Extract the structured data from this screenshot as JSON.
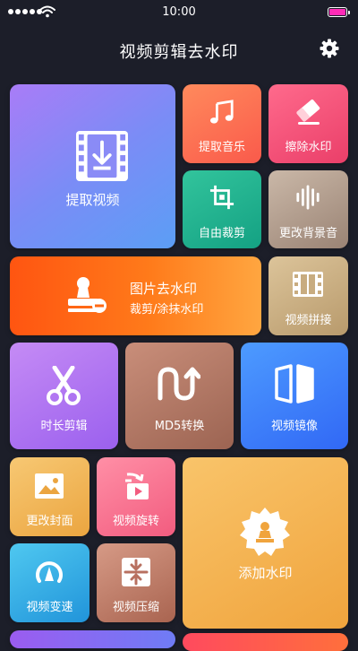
{
  "status_bar": {
    "time": "10:00"
  },
  "header": {
    "title": "视频剪辑去水印"
  },
  "tiles": {
    "extract_video": "提取视频",
    "extract_audio": "提取音乐",
    "erase_watermark": "擦除水印",
    "free_crop": "自由裁剪",
    "change_bgm": "更改背景音",
    "image_watermark": {
      "title": "图片去水印",
      "subtitle": "裁剪/涂抹水印"
    },
    "video_join": "视频拼接",
    "duration_cut": "时长剪辑",
    "md5_convert": "MD5转换",
    "video_mirror": "视频镜像",
    "change_cover": "更改封面",
    "video_rotate": "视频旋转",
    "add_watermark": "添加水印",
    "video_speed": "视频变速",
    "video_compress": "视频压缩"
  },
  "colors": {
    "background": "#1c1e29",
    "battery": "#ff2bb6"
  }
}
